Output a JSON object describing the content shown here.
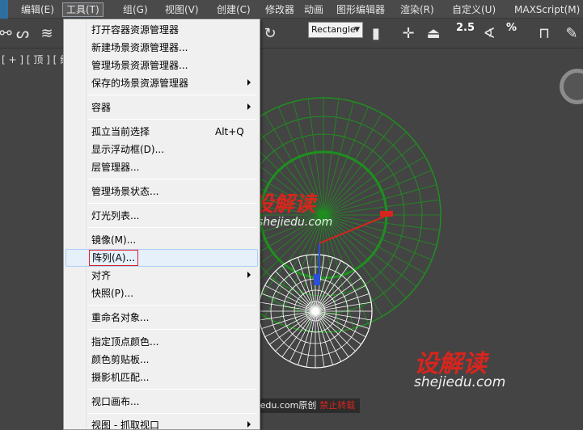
{
  "menubar": {
    "items": [
      {
        "label": "编辑(E)"
      },
      {
        "label": "工具(T)",
        "active": true
      },
      {
        "label": "组(G)"
      },
      {
        "label": "视图(V)"
      },
      {
        "label": "创建(C)"
      },
      {
        "label": "修改器"
      },
      {
        "label": "动画"
      },
      {
        "label": "图形编辑器"
      },
      {
        "label": "渲染(R)"
      },
      {
        "label": "自定义(U)"
      },
      {
        "label": "MAXScript(M)"
      }
    ]
  },
  "toolbar": {
    "selection_region": "Rectangle",
    "snap_angle": "2.5",
    "snap_percent": "%"
  },
  "viewport": {
    "label": "[ + ] [ 顶 ] [ 线框 ]",
    "colors": {
      "background": "#444444",
      "sphere_large": "#1f8f1f",
      "sphere_small": "#ffffff",
      "accent": "#d8251d"
    }
  },
  "watermarks": {
    "logo": "设解读",
    "url": "shejiedu.com",
    "banner_site": "shejiedu.com原创",
    "banner_notice": "禁止转载"
  },
  "tools_menu": {
    "items": [
      {
        "label": "打开容器资源管理器"
      },
      {
        "label": "新建场景资源管理器..."
      },
      {
        "label": "管理场景资源管理器..."
      },
      {
        "label": "保存的场景资源管理器",
        "submenu": true
      },
      {
        "label": "容器",
        "submenu": true
      },
      {
        "label": "孤立当前选择",
        "shortcut": "Alt+Q"
      },
      {
        "label": "显示浮动框(D)..."
      },
      {
        "label": "层管理器..."
      },
      {
        "label": "管理场景状态..."
      },
      {
        "label": "灯光列表..."
      },
      {
        "label": "镜像(M)..."
      },
      {
        "label": "阵列(A)...",
        "highlighted": true
      },
      {
        "label": "对齐",
        "submenu": true
      },
      {
        "label": "快照(P)..."
      },
      {
        "label": "重命名对象..."
      },
      {
        "label": "指定顶点颜色..."
      },
      {
        "label": "颜色剪贴板..."
      },
      {
        "label": "摄影机匹配..."
      },
      {
        "label": "视口画布..."
      },
      {
        "label": "视图 - 抓取视口",
        "submenu": true
      }
    ]
  }
}
